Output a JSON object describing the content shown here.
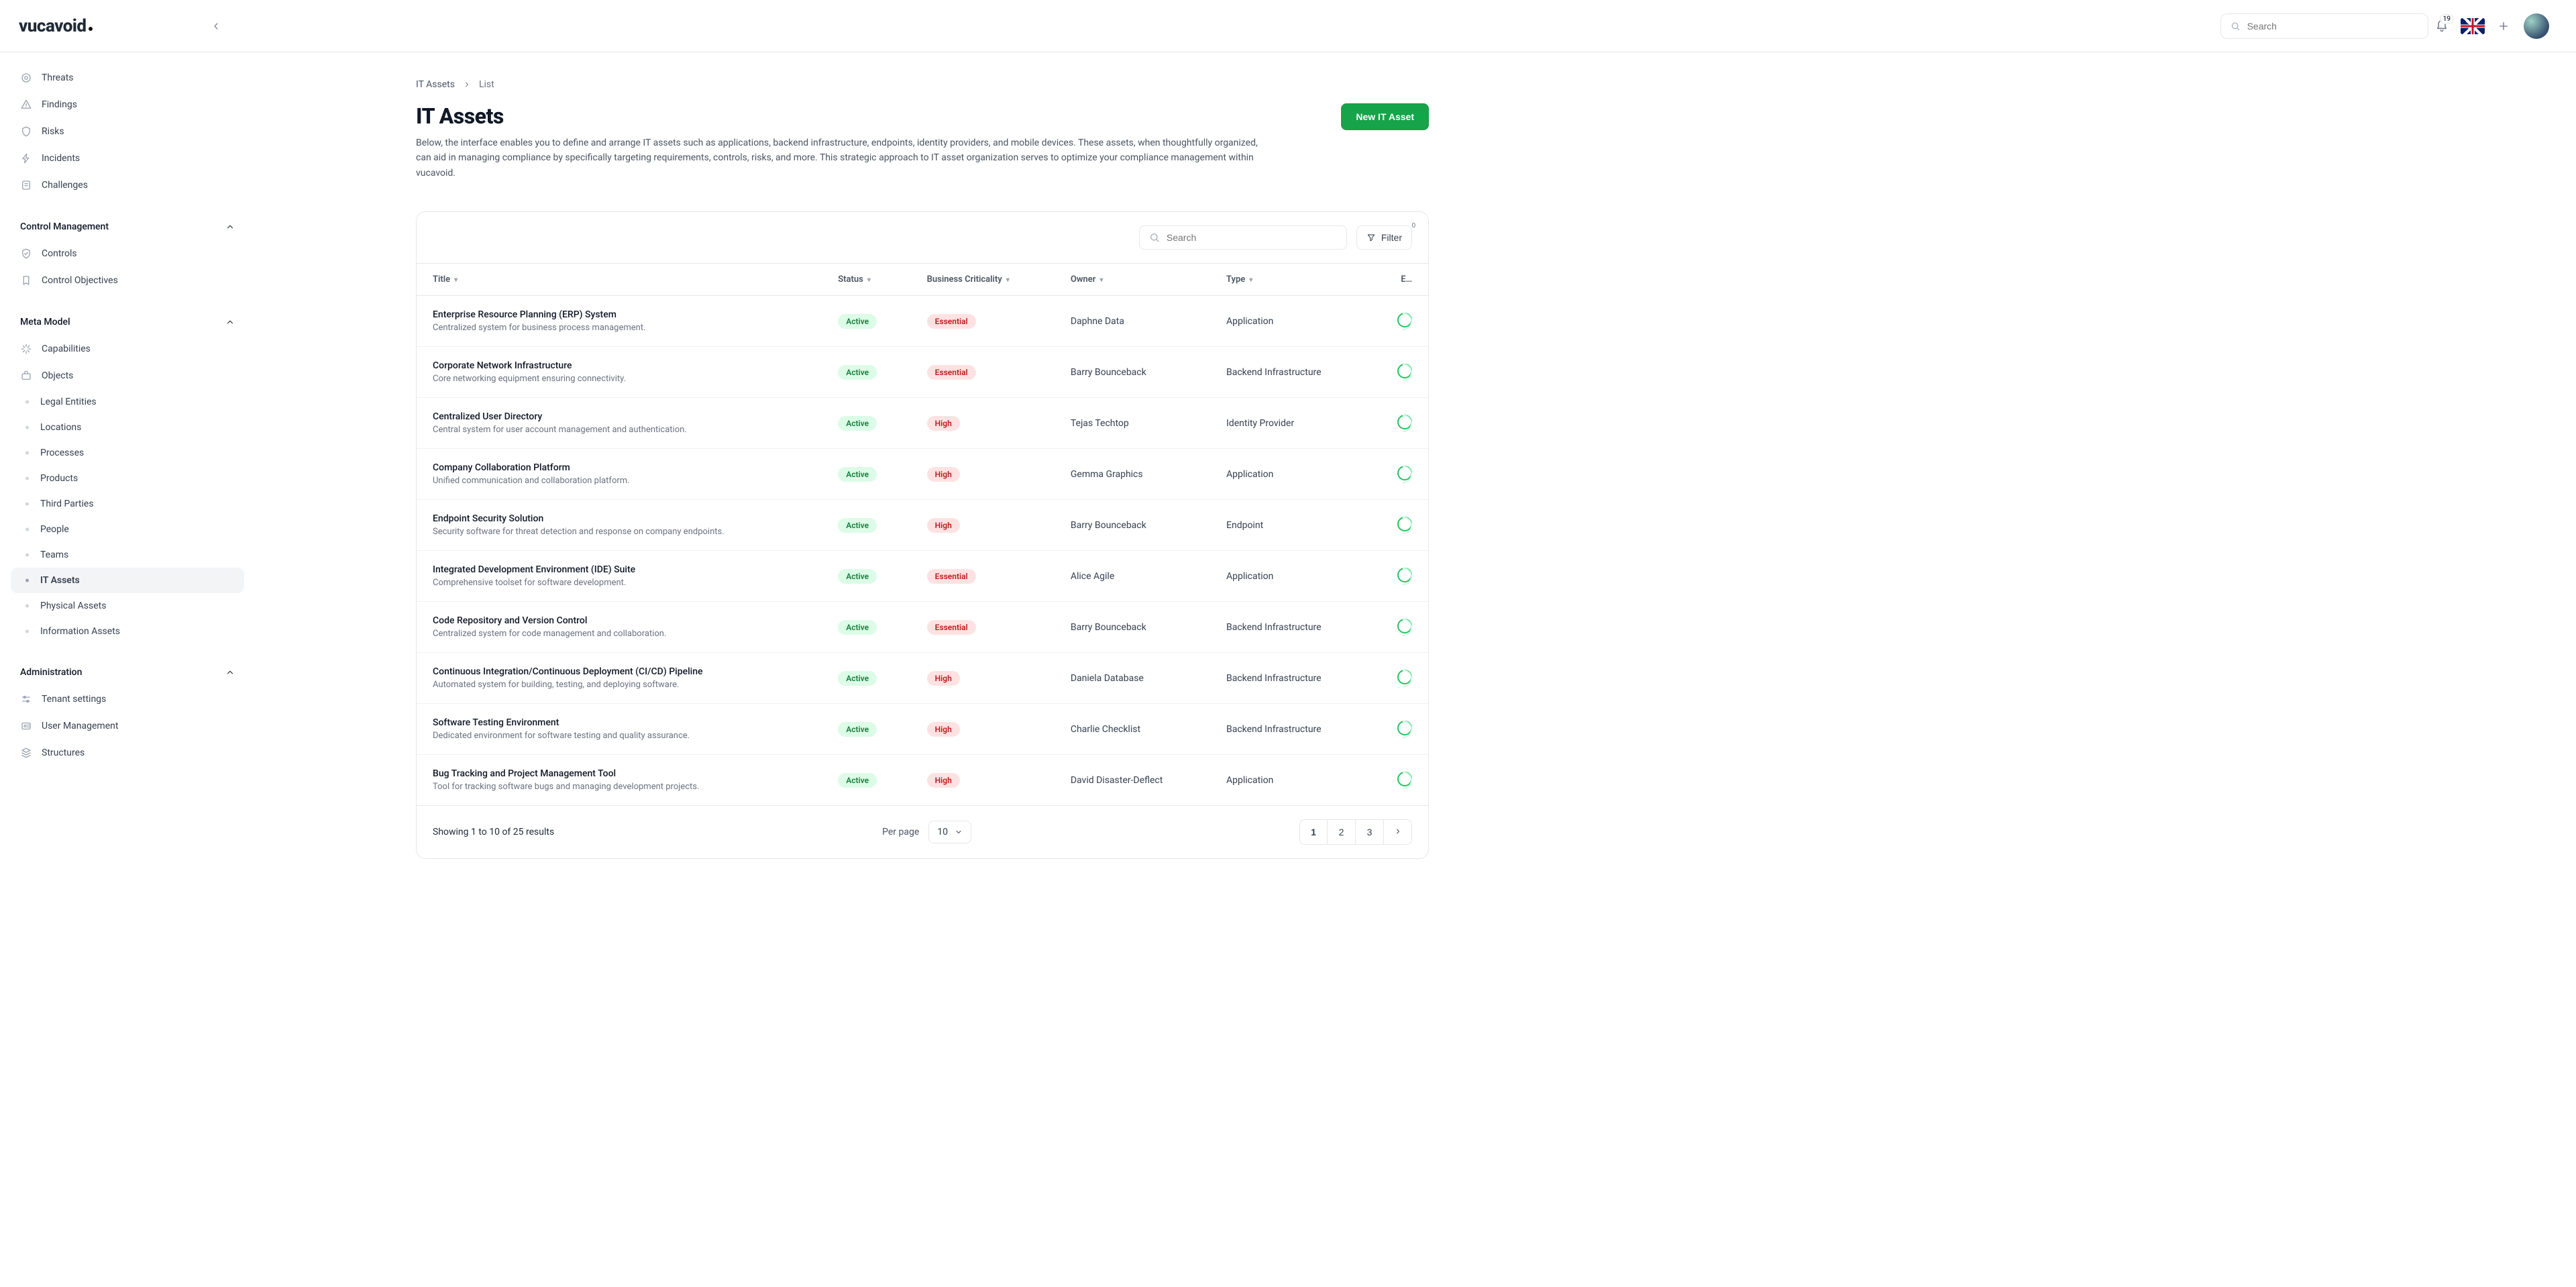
{
  "brand": "vucavoid",
  "top": {
    "search_placeholder": "Search",
    "bell_count": "19"
  },
  "sidebar": {
    "top_items": [
      {
        "label": "Threats",
        "icon": "target-icon"
      },
      {
        "label": "Findings",
        "icon": "warning-triangle-icon"
      },
      {
        "label": "Risks",
        "icon": "shield-icon"
      },
      {
        "label": "Incidents",
        "icon": "bolt-icon"
      },
      {
        "label": "Challenges",
        "icon": "note-icon"
      }
    ],
    "sections": [
      {
        "title": "Control Management",
        "items": [
          {
            "label": "Controls",
            "icon": "shield-check-icon"
          },
          {
            "label": "Control Objectives",
            "icon": "bookmark-icon"
          }
        ]
      },
      {
        "title": "Meta Model",
        "items": [
          {
            "label": "Capabilities",
            "icon": "sparkle-icon"
          },
          {
            "label": "Objects",
            "icon": "briefcase-icon"
          }
        ],
        "subs": [
          {
            "label": "Legal Entities"
          },
          {
            "label": "Locations"
          },
          {
            "label": "Processes"
          },
          {
            "label": "Products"
          },
          {
            "label": "Third Parties"
          },
          {
            "label": "People"
          },
          {
            "label": "Teams"
          },
          {
            "label": "IT Assets",
            "active": true
          },
          {
            "label": "Physical Assets"
          },
          {
            "label": "Information Assets"
          }
        ]
      },
      {
        "title": "Administration",
        "items": [
          {
            "label": "Tenant settings",
            "icon": "sliders-icon"
          },
          {
            "label": "User Management",
            "icon": "id-card-icon"
          },
          {
            "label": "Structures",
            "icon": "layers-icon"
          }
        ]
      }
    ]
  },
  "breadcrumb": {
    "root": "IT Assets",
    "leaf": "List"
  },
  "page": {
    "title": "IT Assets",
    "description": "Below, the interface enables you to define and arrange IT assets such as applications, backend infrastructure, endpoints, identity providers, and mobile devices. These assets, when thoughtfully organized, can aid in managing compliance by specifically targeting requirements, controls, risks, and more. This strategic approach to IT asset organization serves to optimize your compliance management within vucavoid.",
    "primary_button": "New IT Asset"
  },
  "table": {
    "search_placeholder": "Search",
    "filter_label": "Filter",
    "filter_count": "0",
    "columns": [
      "Title",
      "Status",
      "Business Criticality",
      "Owner",
      "Type",
      "E…"
    ],
    "rows": [
      {
        "title": "Enterprise Resource Planning (ERP) System",
        "sub": "Centralized system for business process management.",
        "status": "Active",
        "crit": "Essential",
        "owner": "Daphne Data",
        "type": "Application"
      },
      {
        "title": "Corporate Network Infrastructure",
        "sub": "Core networking equipment ensuring connectivity.",
        "status": "Active",
        "crit": "Essential",
        "owner": "Barry Bounceback",
        "type": "Backend Infrastructure"
      },
      {
        "title": "Centralized User Directory",
        "sub": "Central system for user account management and authentication.",
        "status": "Active",
        "crit": "High",
        "owner": "Tejas Techtop",
        "type": "Identity Provider"
      },
      {
        "title": "Company Collaboration Platform",
        "sub": "Unified communication and collaboration platform.",
        "status": "Active",
        "crit": "High",
        "owner": "Gemma Graphics",
        "type": "Application"
      },
      {
        "title": "Endpoint Security Solution",
        "sub": "Security software for threat detection and response on company endpoints.",
        "status": "Active",
        "crit": "High",
        "owner": "Barry Bounceback",
        "type": "Endpoint"
      },
      {
        "title": "Integrated Development Environment (IDE) Suite",
        "sub": "Comprehensive toolset for software development.",
        "status": "Active",
        "crit": "Essential",
        "owner": "Alice Agile",
        "type": "Application"
      },
      {
        "title": "Code Repository and Version Control",
        "sub": "Centralized system for code management and collaboration.",
        "status": "Active",
        "crit": "Essential",
        "owner": "Barry Bounceback",
        "type": "Backend Infrastructure"
      },
      {
        "title": "Continuous Integration/Continuous Deployment (CI/CD) Pipeline",
        "sub": "Automated system for building, testing, and deploying software.",
        "status": "Active",
        "crit": "High",
        "owner": "Daniela Database",
        "type": "Backend Infrastructure"
      },
      {
        "title": "Software Testing Environment",
        "sub": "Dedicated environment for software testing and quality assurance.",
        "status": "Active",
        "crit": "High",
        "owner": "Charlie Checklist",
        "type": "Backend Infrastructure"
      },
      {
        "title": "Bug Tracking and Project Management Tool",
        "sub": "Tool for tracking software bugs and managing development projects.",
        "status": "Active",
        "crit": "High",
        "owner": "David Disaster-Deflect",
        "type": "Application"
      }
    ],
    "footer": {
      "showing": "Showing 1 to 10 of 25 results",
      "per_page_label": "Per page",
      "per_page_value": "10",
      "pages": [
        "1",
        "2",
        "3"
      ]
    }
  }
}
